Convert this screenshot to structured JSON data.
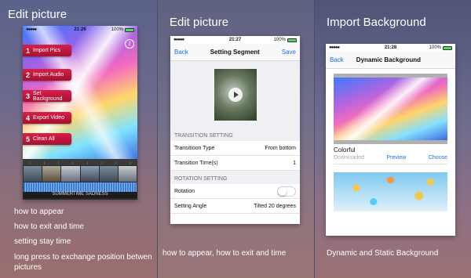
{
  "panel1": {
    "title": "Edit picture",
    "status": {
      "time": "21:26",
      "battery": "100%"
    },
    "menu": [
      {
        "num": "1",
        "label": "Import Pics"
      },
      {
        "num": "2",
        "label": "Import Audio"
      },
      {
        "num": "3",
        "label": "Set Background"
      },
      {
        "num": "4",
        "label": "Export Video"
      },
      {
        "num": "5",
        "label": "Clean All"
      }
    ],
    "track_name": "SUMMERTIME SADNESS",
    "notes": [
      "how to appear",
      "how to exit and time",
      "setting stay time",
      "long press to exchange position betwen pictures"
    ]
  },
  "panel2": {
    "title": "Edit picture",
    "status": {
      "time": "21:27",
      "battery": "100%"
    },
    "nav": {
      "back": "Back",
      "title": "Setting Segment",
      "save": "Save"
    },
    "transition_header": "TRANSITION SETTING",
    "transition_type_label": "Transitioon Type",
    "transition_type_value": "From bottom",
    "transition_time_label": "Transition Time(s)",
    "transition_time_value": "1",
    "rotation_header": "ROTATION SETTING",
    "rotation_label": "Rotation",
    "setting_angle_label": "Setting Angle",
    "setting_angle_value": "Tilted 20 degrees",
    "caption": "how to appear,  how to exit and time"
  },
  "panel3": {
    "title": "Import Background",
    "status": {
      "time": "21:28",
      "battery": "100%"
    },
    "nav": {
      "back": "Back",
      "title": "Dynamic Background"
    },
    "bg1_name": "Colorful",
    "bg1_status": "Downloaded",
    "bg1_preview": "Preview",
    "bg1_choose": "Choose",
    "caption": "Dynamic and Static Background"
  },
  "colors": {
    "accent": "#1a6fe8",
    "menu_red": "#c0183e",
    "toggle_off": "#ffffff",
    "battery": "#4cd964"
  }
}
